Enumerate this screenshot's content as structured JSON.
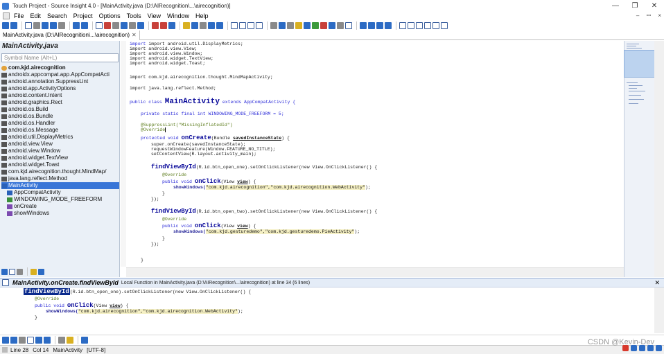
{
  "window": {
    "title": "Touch Project - Source Insight 4.0 - [MainActivity.java (D:\\AIRecognition\\...\\airecognition)]",
    "minimize": "—",
    "maximize": "❐",
    "close": "✕"
  },
  "menu": {
    "items": [
      "File",
      "Edit",
      "Search",
      "Project",
      "Options",
      "Tools",
      "View",
      "Window",
      "Help"
    ],
    "right_controls": [
      "–",
      "ꟷ",
      "×"
    ]
  },
  "tab": {
    "label": "MainActivity.java (D:\\AIRecognition\\...\\airecognition)",
    "close": "✕"
  },
  "symbol_panel": {
    "title": "MainActivity.java",
    "search_placeholder": "Symbol Name (Alt+L)",
    "items": [
      {
        "label": "com.kjd.airecognition",
        "icon": "package-icon",
        "bold": true
      },
      {
        "label": "androidx.appcompat.app.AppCompatActi",
        "icon": "import-icon"
      },
      {
        "label": "android.annotation.SuppressLint",
        "icon": "import-icon"
      },
      {
        "label": "android.app.ActivityOptions",
        "icon": "import-icon"
      },
      {
        "label": "android.content.Intent",
        "icon": "import-icon"
      },
      {
        "label": "android.graphics.Rect",
        "icon": "import-icon"
      },
      {
        "label": "android.os.Build",
        "icon": "import-icon"
      },
      {
        "label": "android.os.Bundle",
        "icon": "import-icon"
      },
      {
        "label": "android.os.Handler",
        "icon": "import-icon"
      },
      {
        "label": "android.os.Message",
        "icon": "import-icon"
      },
      {
        "label": "android.util.DisplayMetrics",
        "icon": "import-icon"
      },
      {
        "label": "android.view.View",
        "icon": "import-icon"
      },
      {
        "label": "android.view.Window",
        "icon": "import-icon"
      },
      {
        "label": "android.widget.TextView",
        "icon": "import-icon"
      },
      {
        "label": "android.widget.Toast",
        "icon": "import-icon"
      },
      {
        "label": "com.kjd.airecognition.thought.MindMap/",
        "icon": "import-icon"
      },
      {
        "label": "java.lang.reflect.Method",
        "icon": "import-icon"
      },
      {
        "label": "MainActivity",
        "icon": "class-icon",
        "selected": true
      },
      {
        "label": "AppCompatActivity",
        "icon": "superclass-icon",
        "indent": true
      },
      {
        "label": "WINDOWING_MODE_FREEFORM",
        "icon": "field-icon",
        "indent": true
      },
      {
        "label": "onCreate",
        "icon": "method-icon",
        "indent": true
      },
      {
        "label": "showWindows",
        "icon": "method-icon",
        "indent": true
      }
    ]
  },
  "code": {
    "lines": [
      "import android.util.DisplayMetrics;",
      "import android.view.View;",
      "import android.view.Window;",
      "import android.widget.TextView;",
      "import android.widget.Toast;",
      "import com.kjd.airecognition.thought.MindMapActivity;",
      "import java.lang.reflect.Method;",
      "public class",
      "MainActivity",
      "extends AppCompatActivity {",
      "private static final int WINDOWING_MODE_FREEFORM = 5;",
      "@SuppressLint(\"MissingInflatedId\")",
      "@Override",
      "protected void",
      "onCreate",
      "(Bundle",
      "savedInstanceState",
      ") {",
      "super.onCreate(savedInstanceState);",
      "requestWindowFeature(Window.FEATURE_NO_TITLE);",
      "setContentView(R.layout.activity_main);",
      "findViewById",
      "(R.id.btn_open_one).setOnClickListener(new View.OnClickListener() {",
      "@Override",
      "public void",
      "onClick",
      "(View",
      "view",
      ") {",
      "showWindows(",
      "\"com.kjd.airecognition\",\"com.kjd.airecognition.WebActivity\"",
      ");",
      "}",
      "});",
      "(R.id.btn_open_two).setOnClickListener(new View.OnClickListener() {",
      "\"com.kjd.gesturedemo\",\"com.kjd.gesturedemo.PieActivity\"",
      "}"
    ]
  },
  "context": {
    "title": "MainActivity.onCreate.findViewById",
    "description": "Local Function in MainActivity.java (D:\\AIRecognition\\...\\airecognition) at line 34 (6 lines)",
    "close": "✕"
  },
  "status": {
    "line": "Line 28",
    "col": "Col 14",
    "symbol": "MainActivity",
    "encoding": "[UTF-8]"
  },
  "watermark": "CSDN @Kevin-Dev"
}
